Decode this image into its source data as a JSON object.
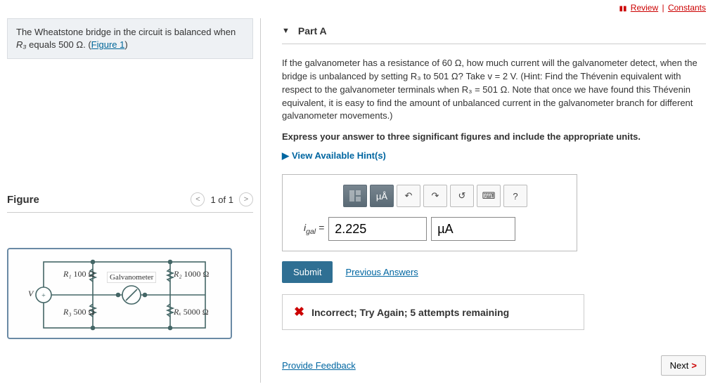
{
  "top_links": {
    "review": "Review",
    "constants": "Constants"
  },
  "problem": {
    "prefix": "The Wheatstone bridge in the circuit is balanced when ",
    "var": "R₃",
    "middle": " equals 500 Ω. (",
    "link": "Figure 1",
    "suffix": ")"
  },
  "figure": {
    "title": "Figure",
    "pager": "1 of 1",
    "labels": {
      "v": "V",
      "r1": "R₁",
      "r1v": "100 Ω",
      "galv": "Galvanometer",
      "r2": "R₂",
      "r2v": "1000 Ω",
      "r3": "R₃",
      "r3v": "500 Ω",
      "rx": "Rₓ",
      "rxv": "5000 Ω"
    }
  },
  "part": {
    "title": "Part A",
    "question": "If the galvanometer has a resistance of 60 Ω, how much current will the galvanometer detect, when the bridge is unbalanced by setting R₃ to 501 Ω? Take v = 2 V. (Hint: Find the Thévenin equivalent with respect to the galvanometer terminals when R₃ = 501 Ω. Note that once we have found this Thévenin equivalent, it is easy to find the amount of unbalanced current in the galvanometer branch for different galvanometer movements.)",
    "instruction": "Express your answer to three significant figures and include the appropriate units.",
    "hint_link": "View Available Hint(s)",
    "tools": {
      "units_btn": "µÅ",
      "help": "?"
    },
    "answer": {
      "label": "i₍gal₎ =",
      "value": "2.225",
      "units": "µA"
    },
    "submit": "Submit",
    "previous": "Previous Answers",
    "feedback": "Incorrect; Try Again; 5 attempts remaining"
  },
  "bottom": {
    "feedback": "Provide Feedback",
    "next": "Next"
  }
}
